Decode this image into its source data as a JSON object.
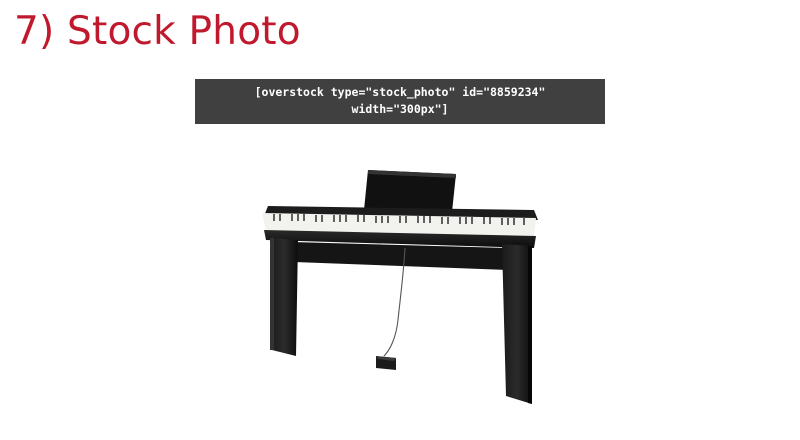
{
  "section": {
    "title": "7) Stock Photo"
  },
  "shortcode": {
    "line1": "[overstock type=\"stock_photo\" id=\"8859234\"",
    "line2": "width=\"300px\"]"
  },
  "product_image": {
    "subject": "digital-piano-with-stand-icon",
    "body_color": "#141414",
    "key_color": "#f2f2ee"
  }
}
